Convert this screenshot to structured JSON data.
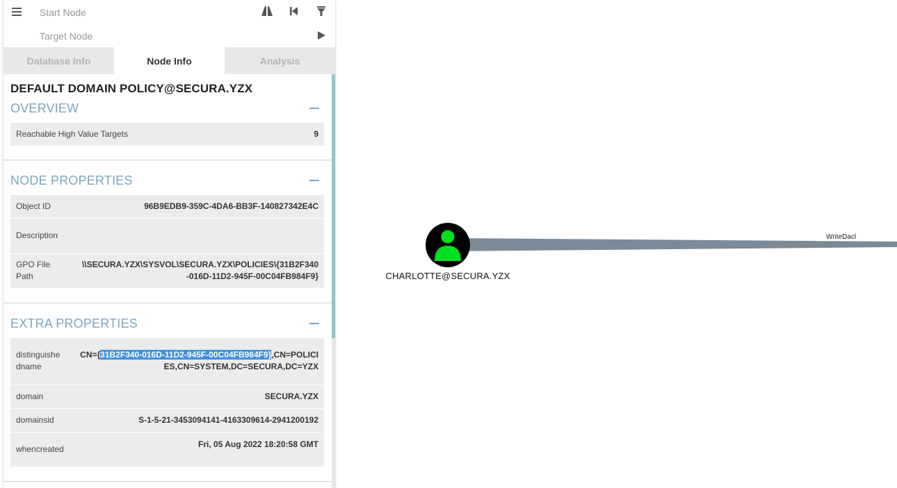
{
  "search": {
    "start_placeholder": "Start Node",
    "target_placeholder": "Target Node"
  },
  "tabs": [
    {
      "label": "Database Info",
      "active": false
    },
    {
      "label": "Node Info",
      "active": true
    },
    {
      "label": "Analysis",
      "active": false
    }
  ],
  "node": {
    "title": "DEFAULT DOMAIN POLICY@SECURA.YZX"
  },
  "sections": {
    "overview": {
      "title": "OVERVIEW",
      "rows": [
        {
          "key": "Reachable High Value Targets",
          "value": "9"
        }
      ]
    },
    "node_properties": {
      "title": "NODE PROPERTIES",
      "rows": [
        {
          "key": "Object ID",
          "value": "96B9EDB9-359C-4DA6-BB3F-140827342E4C"
        },
        {
          "key": "Description",
          "value": ""
        },
        {
          "key": "GPO File Path",
          "value": "\\\\SECURA.YZX\\SYSVOL\\SECURA.YZX\\POLICIES\\{31B2F340-016D-11D2-945F-00C04FB984F9}"
        }
      ]
    },
    "extra_properties": {
      "title": "EXTRA PROPERTIES",
      "rows": [
        {
          "key": "distinguishedname",
          "value_prefix": "CN={",
          "value_highlight": "31B2F340-016D-11D2-945F-00C04FB984F9}",
          "value_suffix": ",CN=POLICIES,CN=SYSTEM,DC=SECURA,DC=YZX"
        },
        {
          "key": "domain",
          "value": "SECURA.YZX"
        },
        {
          "key": "domainsid",
          "value": "S-1-5-21-3453094141-4163309614-2941200192"
        },
        {
          "key": "whencreated",
          "value": "Fri, 05 Aug 2022 18:20:58 GMT"
        }
      ]
    }
  },
  "graph": {
    "node_label": "CHARLOTTE@SECURA.YZX",
    "node_color": "#00e020",
    "edge_label": "WriteDacl",
    "edge_color": "#7a8a96"
  },
  "icons": [
    "menu-icon",
    "pathfinding-icon",
    "back-icon",
    "filter-icon",
    "play-icon",
    "user-icon"
  ]
}
